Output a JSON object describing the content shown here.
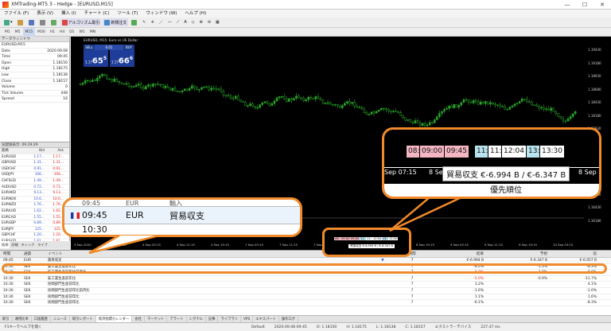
{
  "window": {
    "title": "XMTrading-MT5 3 - Hedge - [EURUSD,M15]"
  },
  "menu": [
    "ファイル (F)",
    "表示 (V)",
    "挿入 (I)",
    "チャート (C)",
    "ツール (T)",
    "ウィンドウ (W)",
    "ヘルプ (H)"
  ],
  "toolbar": {
    "algo_label": "アルゴリズム取引",
    "new_order_label": "新規注文"
  },
  "timeframes": [
    "M1",
    "M5",
    "M15",
    "M30",
    "H1",
    "H4",
    "D1",
    "W1",
    "MN"
  ],
  "data_window": {
    "title": "データウィンドウ",
    "symbol": "EURUSD,M15",
    "rows": [
      {
        "k": "Date",
        "v": "2020.09.08"
      },
      {
        "k": "Time",
        "v": "09:45"
      },
      {
        "k": "Open",
        "v": "1.18150"
      },
      {
        "k": "High",
        "v": "1.18175"
      },
      {
        "k": "Low",
        "v": "1.18138"
      },
      {
        "k": "Close",
        "v": "1.18157"
      },
      {
        "k": "Volume",
        "v": "0"
      },
      {
        "k": "Tick Volume",
        "v": "448"
      },
      {
        "k": "Spread",
        "v": "16"
      }
    ]
  },
  "market_watch": {
    "title": "気配値表示: 09:29:29",
    "col_symbol": "銘柄",
    "col_bid": "Bid",
    "col_ask": "Ask",
    "rows": [
      {
        "s": "EURUSD",
        "b": "1.17...",
        "a": "1.17..."
      },
      {
        "s": "GBPUSD",
        "b": "1.31...",
        "a": "1.31..."
      },
      {
        "s": "USDCHF",
        "b": "0.91...",
        "a": "0.91..."
      },
      {
        "s": "USDJPY",
        "b": "106...",
        "a": "106..."
      },
      {
        "s": "CHFSGD",
        "b": "1.49...",
        "a": "1.49..."
      },
      {
        "s": "AUDUSD",
        "b": "0.72...",
        "a": "0.72..."
      },
      {
        "s": "EURHKD",
        "b": "9.13...",
        "a": "9.13..."
      },
      {
        "s": "EURNOK",
        "b": "10.6...",
        "a": "10.6..."
      },
      {
        "s": "EURNZD",
        "b": "1.76...",
        "a": "1.76..."
      },
      {
        "s": "EURAUD",
        "b": "1.62...",
        "a": "1.62..."
      },
      {
        "s": "EURCAD",
        "b": "1.55...",
        "a": "1.55..."
      },
      {
        "s": "EURGBP",
        "b": "0.89...",
        "a": "0.89..."
      },
      {
        "s": "EURJPY",
        "b": "125...",
        "a": "125..."
      },
      {
        "s": "GBPCHF",
        "b": "1.20...",
        "a": "1.20..."
      },
      {
        "s": "EURSGD",
        "b": "1.61...",
        "a": "1.61..."
      }
    ],
    "tabs": [
      "銘柄",
      "詳細",
      "ティック",
      "ライブ"
    ]
  },
  "chart": {
    "header": "EURUSD, M15: Euro vs US Dollar",
    "sell_label": "SELL",
    "buy_label": "BUY",
    "lot": "0.01",
    "sell_big": "65",
    "sell_sup": "5",
    "sell_prefix": "1.17",
    "buy_big": "66",
    "buy_sup": "6",
    "buy_prefix": "1.17",
    "price_labels": [
      "1.19430",
      "1.19180",
      "1.18930",
      "1.18680",
      "1.18430",
      "1.18180",
      "1.17930",
      "1.17680",
      "1.17430",
      "1.17180",
      "1.16930",
      "1.16680",
      "1.16430",
      "1.16180"
    ],
    "time_labels": [
      "3 Sep 2020",
      "3 Sep 19:15",
      "4 Sep 03:15",
      "4 Sep 11:15",
      "4 Sep 19:15",
      "7 Sep 03:15",
      "7 Sep 11:15",
      "7 Sep 19:15",
      "8 Sep 03:15",
      "8 Sep 11:15",
      "8 Sep 19:15",
      "9 Sep 03:15",
      "9 Sep 11:15",
      "9 Sep 19:15",
      "10 Sep 03:15"
    ],
    "tooltip": "貿易収支 €-6.994 B / €-6.347 B"
  },
  "zoom_callout": {
    "time_row0": "09:45",
    "cur_row0": "EUR",
    "evt_row0": "輸入",
    "time": "09:45",
    "currency": "EUR",
    "event": "貿易収支",
    "time_row2": "10:30"
  },
  "zoom_tags": {
    "tags": [
      {
        "t": "08:",
        "c": "#f4b6c2"
      },
      {
        "t": "09:00",
        "c": "#f4b6c2"
      },
      {
        "t": "09:45",
        "c": "#f4b6c2"
      },
      {
        "t": "11:",
        "c": "#b8e4ef"
      },
      {
        "t": "11:",
        "c": "#ffffff"
      },
      {
        "t": "12:04",
        "c": "#ffffff"
      },
      {
        "t": "13:",
        "c": "#b8e4ef"
      },
      {
        "t": "13:30",
        "c": "#ffffff"
      }
    ],
    "axis_left": "Sep 07:15",
    "axis_mid": "8 Se",
    "axis_right": "8 Sep",
    "tooltip": "貿易収支 €-6.994 B / €-6.347 B",
    "priority": "優先順位"
  },
  "calendar": {
    "headers": {
      "time": "時間",
      "currency": "通貨",
      "event": "イベント",
      "priority": "優先順位",
      "period": "期間",
      "actual": "結果",
      "forecast": "予想",
      "previous": "前"
    },
    "rows": [
      {
        "time": "09:45",
        "cur": "EUR",
        "event": "貿易収支",
        "pri": "▼",
        "period": "7",
        "actual": "€-6.994 B",
        "forecast": "€-6.347 B",
        "prev": "€-6.057 B",
        "neg": false
      },
      {
        "time": "10:30",
        "cur": "SEK",
        "event": "鉱工業生産前年比",
        "pri": "",
        "period": "7",
        "actual": "-8.0%",
        "forecast": "-1.3%",
        "prev": "-8.3%",
        "neg": false
      },
      {
        "time": "10:30",
        "cur": "SEK",
        "event": "鉱工業生産前年比前月比",
        "pri": "",
        "period": "7",
        "actual": "-6.0%",
        "forecast": "-1.8%",
        "prev": "-9.8%",
        "neg": true
      },
      {
        "time": "10:30",
        "cur": "SEK",
        "event": "鉱工業生産前年比",
        "pri": "",
        "period": "7",
        "actual": "-5.0%",
        "forecast": "-0.9%",
        "prev": "-11.7%",
        "neg": true
      },
      {
        "time": "10:30",
        "cur": "SEK",
        "event": "民間部門生産前年比",
        "pri": "",
        "period": "7",
        "actual": "3.2%",
        "forecast": "",
        "prev": "4.1%",
        "neg": false
      },
      {
        "time": "10:30",
        "cur": "SEK",
        "event": "民間部門生産前年比前月比",
        "pri": "",
        "period": "7",
        "actual": "-1.6%",
        "forecast": "",
        "prev": "-1.0%",
        "neg": false
      },
      {
        "time": "10:30",
        "cur": "SEK",
        "event": "民間部門生産前年比",
        "pri": "",
        "period": "7",
        "actual": "1.1%",
        "forecast": "",
        "prev": "1.6%",
        "neg": false
      },
      {
        "time": "10:30",
        "cur": "SEK",
        "event": "民間部門生産前年比",
        "pri": "",
        "period": "7",
        "actual": "-6.1%",
        "forecast": "",
        "prev": "-8.3%",
        "neg": false
      }
    ]
  },
  "bottom_tabs": [
    "取引",
    "運用比率",
    "口座履歴",
    "ニュース",
    "取引レポート",
    "経済指標カレンダー",
    "会社",
    "マーケット",
    "アラート",
    "シグナル",
    "記事",
    "ライブラリ",
    "VPS",
    "エキスパート",
    "操作ログ"
  ],
  "status": {
    "help": "F1キーでヘルプを開く",
    "profile": "Default",
    "time": "2020.09.08 09:45",
    "open": "O: 1.18150",
    "high": "H: 1.18175",
    "low": "L: 1.18138",
    "close": "C: 1.18157",
    "trader": "エクストラ・デバイス",
    "ping": "227.47 ms"
  },
  "small_callout": {
    "tags": [
      "08:",
      "09:00",
      "09:45",
      "11:",
      "11:",
      "12:04",
      "13:",
      "13:30"
    ],
    "tooltip": "貿易収支 €-6.994 B / €-6.347 B"
  }
}
